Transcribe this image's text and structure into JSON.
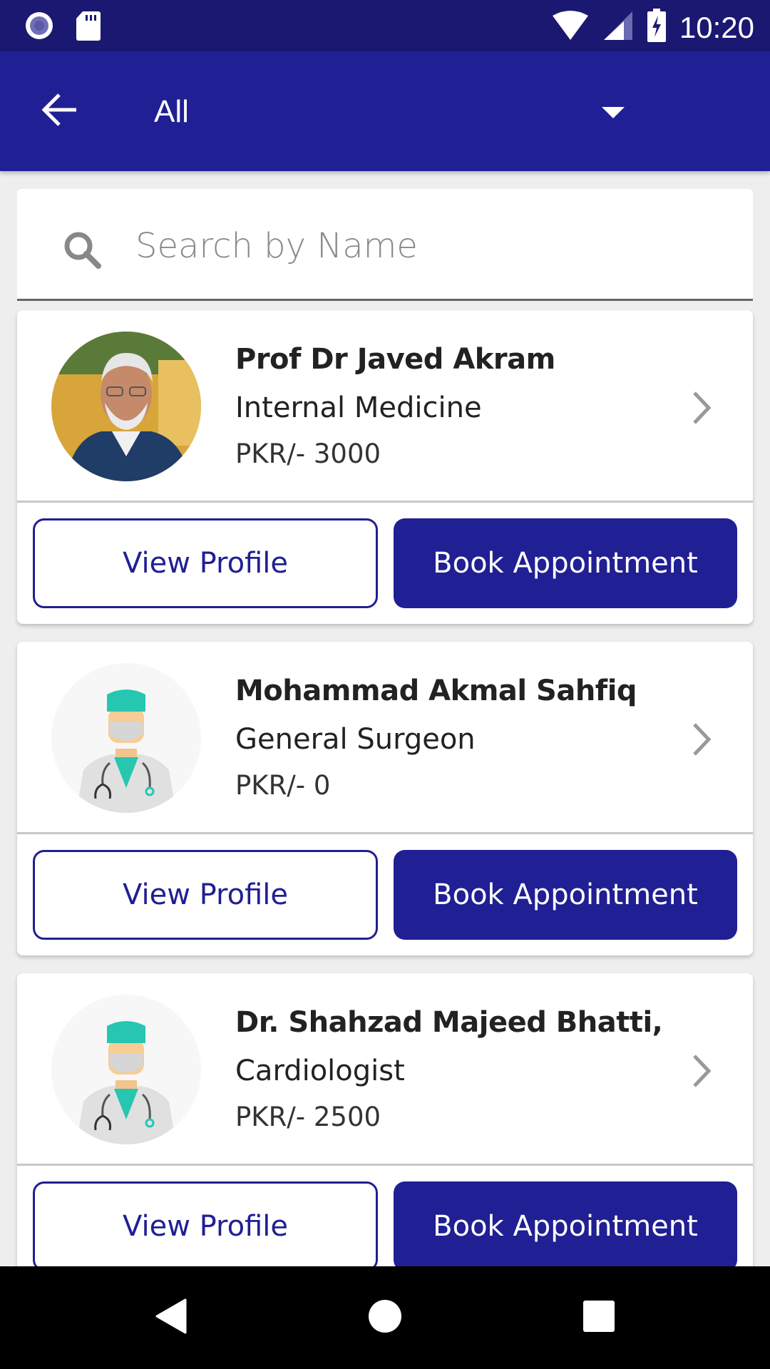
{
  "status_bar": {
    "time": "10:20",
    "left_icons": [
      "notification-circle-icon",
      "sd-card-icon"
    ],
    "right_icons": [
      "wifi-icon",
      "signal-icon",
      "battery-charging-icon"
    ]
  },
  "app_bar": {
    "back_icon": "arrow-back-icon",
    "filter_selected": "All",
    "filter_icon": "dropdown-caret-icon"
  },
  "search": {
    "placeholder": "Search by Name",
    "value": "",
    "icon": "search-icon"
  },
  "doctors": [
    {
      "name": "Prof Dr Javed Akram",
      "specialty": "Internal Medicine",
      "fee": "PKR/- 3000",
      "avatar": "photo",
      "view_label": "View Profile",
      "book_label": "Book Appointment"
    },
    {
      "name": "Mohammad Akmal Sahfiq",
      "specialty": "General Surgeon",
      "fee": "PKR/- 0",
      "avatar": "doctor-placeholder",
      "view_label": "View Profile",
      "book_label": "Book Appointment"
    },
    {
      "name": "Dr. Shahzad Majeed Bhatti,",
      "specialty": "Cardiologist",
      "fee": "PKR/- 2500",
      "avatar": "doctor-placeholder",
      "view_label": "View Profile",
      "book_label": "Book Appointment"
    }
  ],
  "nav_bar": {
    "buttons": [
      "nav-back-icon",
      "nav-home-icon",
      "nav-recents-icon"
    ]
  },
  "colors": {
    "primary": "#201f93",
    "status_bar": "#1a1870",
    "background": "#eeeeee"
  }
}
